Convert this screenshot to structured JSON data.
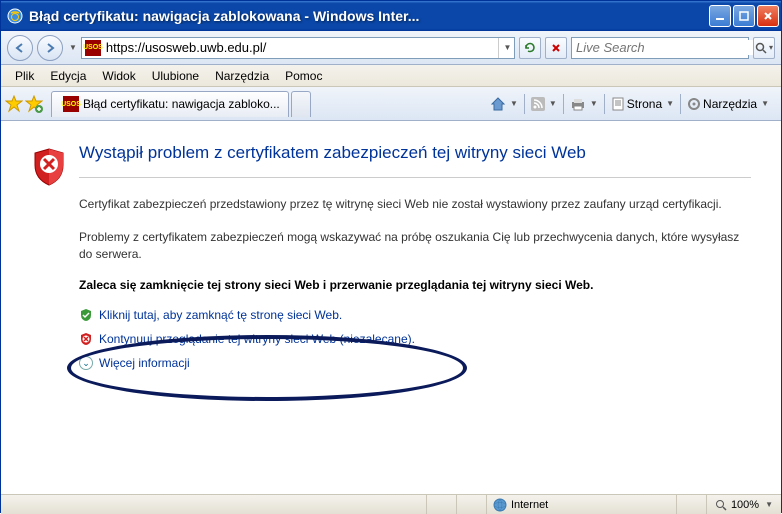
{
  "window": {
    "title": "Błąd certyfikatu: nawigacja zablokowana - Windows Inter..."
  },
  "nav": {
    "url": "https://usosweb.uwb.edu.pl/",
    "search_placeholder": "Live Search"
  },
  "menu": {
    "items": [
      "Plik",
      "Edycja",
      "Widok",
      "Ulubione",
      "Narzędzia",
      "Pomoc"
    ]
  },
  "tab": {
    "label": "Błąd certyfikatu: nawigacja zabloko..."
  },
  "toolbar": {
    "page_label": "Strona",
    "tools_label": "Narzędzia"
  },
  "cert": {
    "heading": "Wystąpił problem z certyfikatem zabezpieczeń tej witryny sieci Web",
    "para1": "Certyfikat zabezpieczeń przedstawiony przez tę witrynę sieci Web nie został wystawiony przez zaufany urząd certyfikacji.",
    "para2": "Problemy z certyfikatem zabezpieczeń mogą wskazywać na próbę oszukania Cię lub przechwycenia danych, które wysyłasz do serwera.",
    "recommend": "Zaleca się zamknięcie tej strony sieci Web i przerwanie przeglądania tej witryny sieci Web.",
    "action_close": "Kliknij tutaj, aby zamknąć tę stronę sieci Web.",
    "action_continue": "Kontynuuj przeglądanie tej witryny sieci Web (niezalecane).",
    "more_info": "Więcej informacji"
  },
  "status": {
    "zone": "Internet",
    "zoom": "100%"
  }
}
